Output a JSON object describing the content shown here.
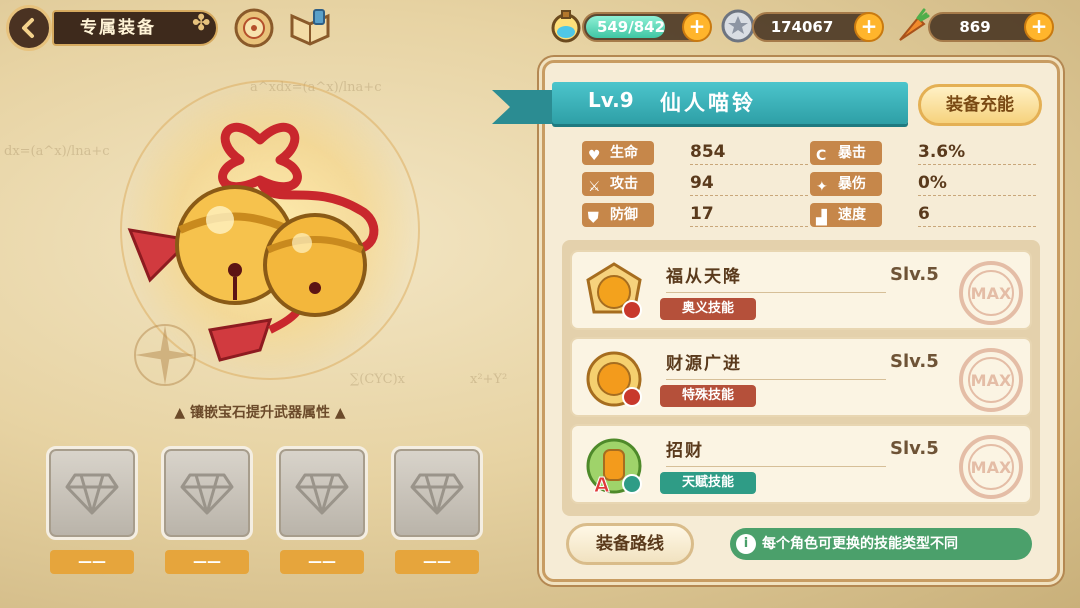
{
  "header": {
    "title": "专属装备"
  },
  "resources": {
    "stamina": "549/842",
    "coins": "174067",
    "carrots": "869"
  },
  "background_formulas": [
    "a^xdx=(a^x)/lna+c",
    "dx=(a^x)/lna+c",
    "∑(CYC)x",
    "x²+Y²"
  ],
  "equipment": {
    "gem_hint": "镶嵌宝石提升武器属性",
    "slots": [
      {
        "label": "——"
      },
      {
        "label": "——"
      },
      {
        "label": "——"
      },
      {
        "label": "——"
      }
    ]
  },
  "panel": {
    "level": "Lv.9",
    "name": "仙人喵铃",
    "charge_button": "装备充能",
    "stats": [
      {
        "label": "生命",
        "value": "854",
        "icon": "heart-icon"
      },
      {
        "label": "暴击",
        "value": "3.6%",
        "icon": "crit-icon"
      },
      {
        "label": "攻击",
        "value": "94",
        "icon": "sword-icon"
      },
      {
        "label": "暴伤",
        "value": "0%",
        "icon": "crit-damage-icon"
      },
      {
        "label": "防御",
        "value": "17",
        "icon": "shield-icon"
      },
      {
        "label": "速度",
        "value": "6",
        "icon": "boot-icon"
      }
    ],
    "skills": [
      {
        "name": "福从天降",
        "type": "奥义技能",
        "level": "Slv.5",
        "type_color": "#b5503a"
      },
      {
        "name": "财源广进",
        "type": "特殊技能",
        "level": "Slv.5",
        "type_color": "#b5503a"
      },
      {
        "name": "招财",
        "type": "天赋技能",
        "level": "Slv.5",
        "type_color": "#2f9c86"
      }
    ],
    "max_stamp": "MAX",
    "route_button": "装备路线",
    "info_text": "每个角色可更换的技能类型不同",
    "info_glyph": "i"
  },
  "colors": {
    "accent_teal": "#3fb3ba",
    "accent_orange": "#ffb52c",
    "stat_tag": "#c6874a"
  }
}
